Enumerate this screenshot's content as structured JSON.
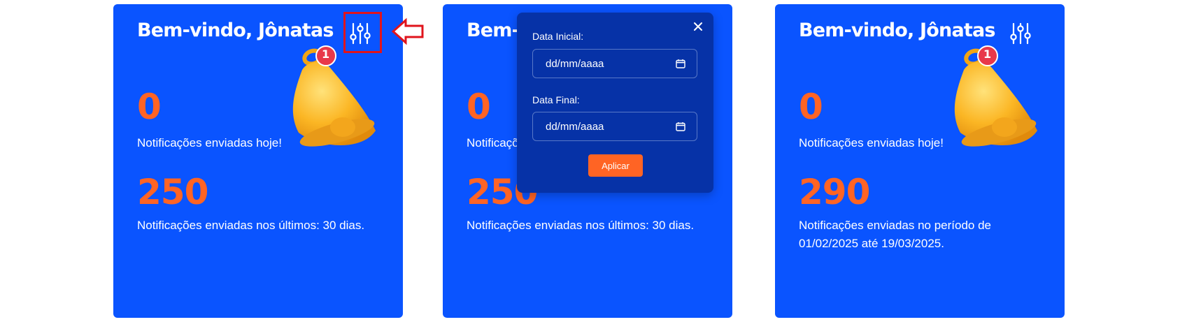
{
  "cards": [
    {
      "title": "Bem-vindo, Jônatas",
      "icon": "sliders-icon",
      "today_count": "0",
      "today_label": "Notificações enviadas hoje!",
      "period_count": "250",
      "period_label": "Notificações enviadas nos últimos: 30 dias."
    },
    {
      "title": "Bem-vindo, Jônatas",
      "today_count": "0",
      "today_label": "Notificações enviadas hoje!",
      "period_count": "250",
      "period_label": "Notificações enviadas nos últimos: 30 dias."
    },
    {
      "title": "Bem-vindo, Jônatas",
      "icon": "sliders-icon",
      "today_count": "0",
      "today_label": "Notificações enviadas hoje!",
      "period_count": "290",
      "period_label": "Notificações enviadas no período de 01/02/2025 até 19/03/2025."
    }
  ],
  "bell": {
    "badge": "1",
    "icon": "bell-icon"
  },
  "filter_popup": {
    "start_label": "Data Inicial:",
    "start_placeholder": "dd/mm/aaaa",
    "end_label": "Data Final:",
    "end_placeholder": "dd/mm/aaaa",
    "apply_label": "Aplicar",
    "close_icon": "close-icon",
    "calendar_icon": "calendar-icon"
  },
  "annotation": {
    "highlight_color": "#e0141c",
    "arrow_icon": "arrow-left-icon"
  },
  "colors": {
    "card_bg": "#0a54ff",
    "popup_bg": "#0632a7",
    "accent": "#ff6424",
    "text": "#ffffff"
  }
}
